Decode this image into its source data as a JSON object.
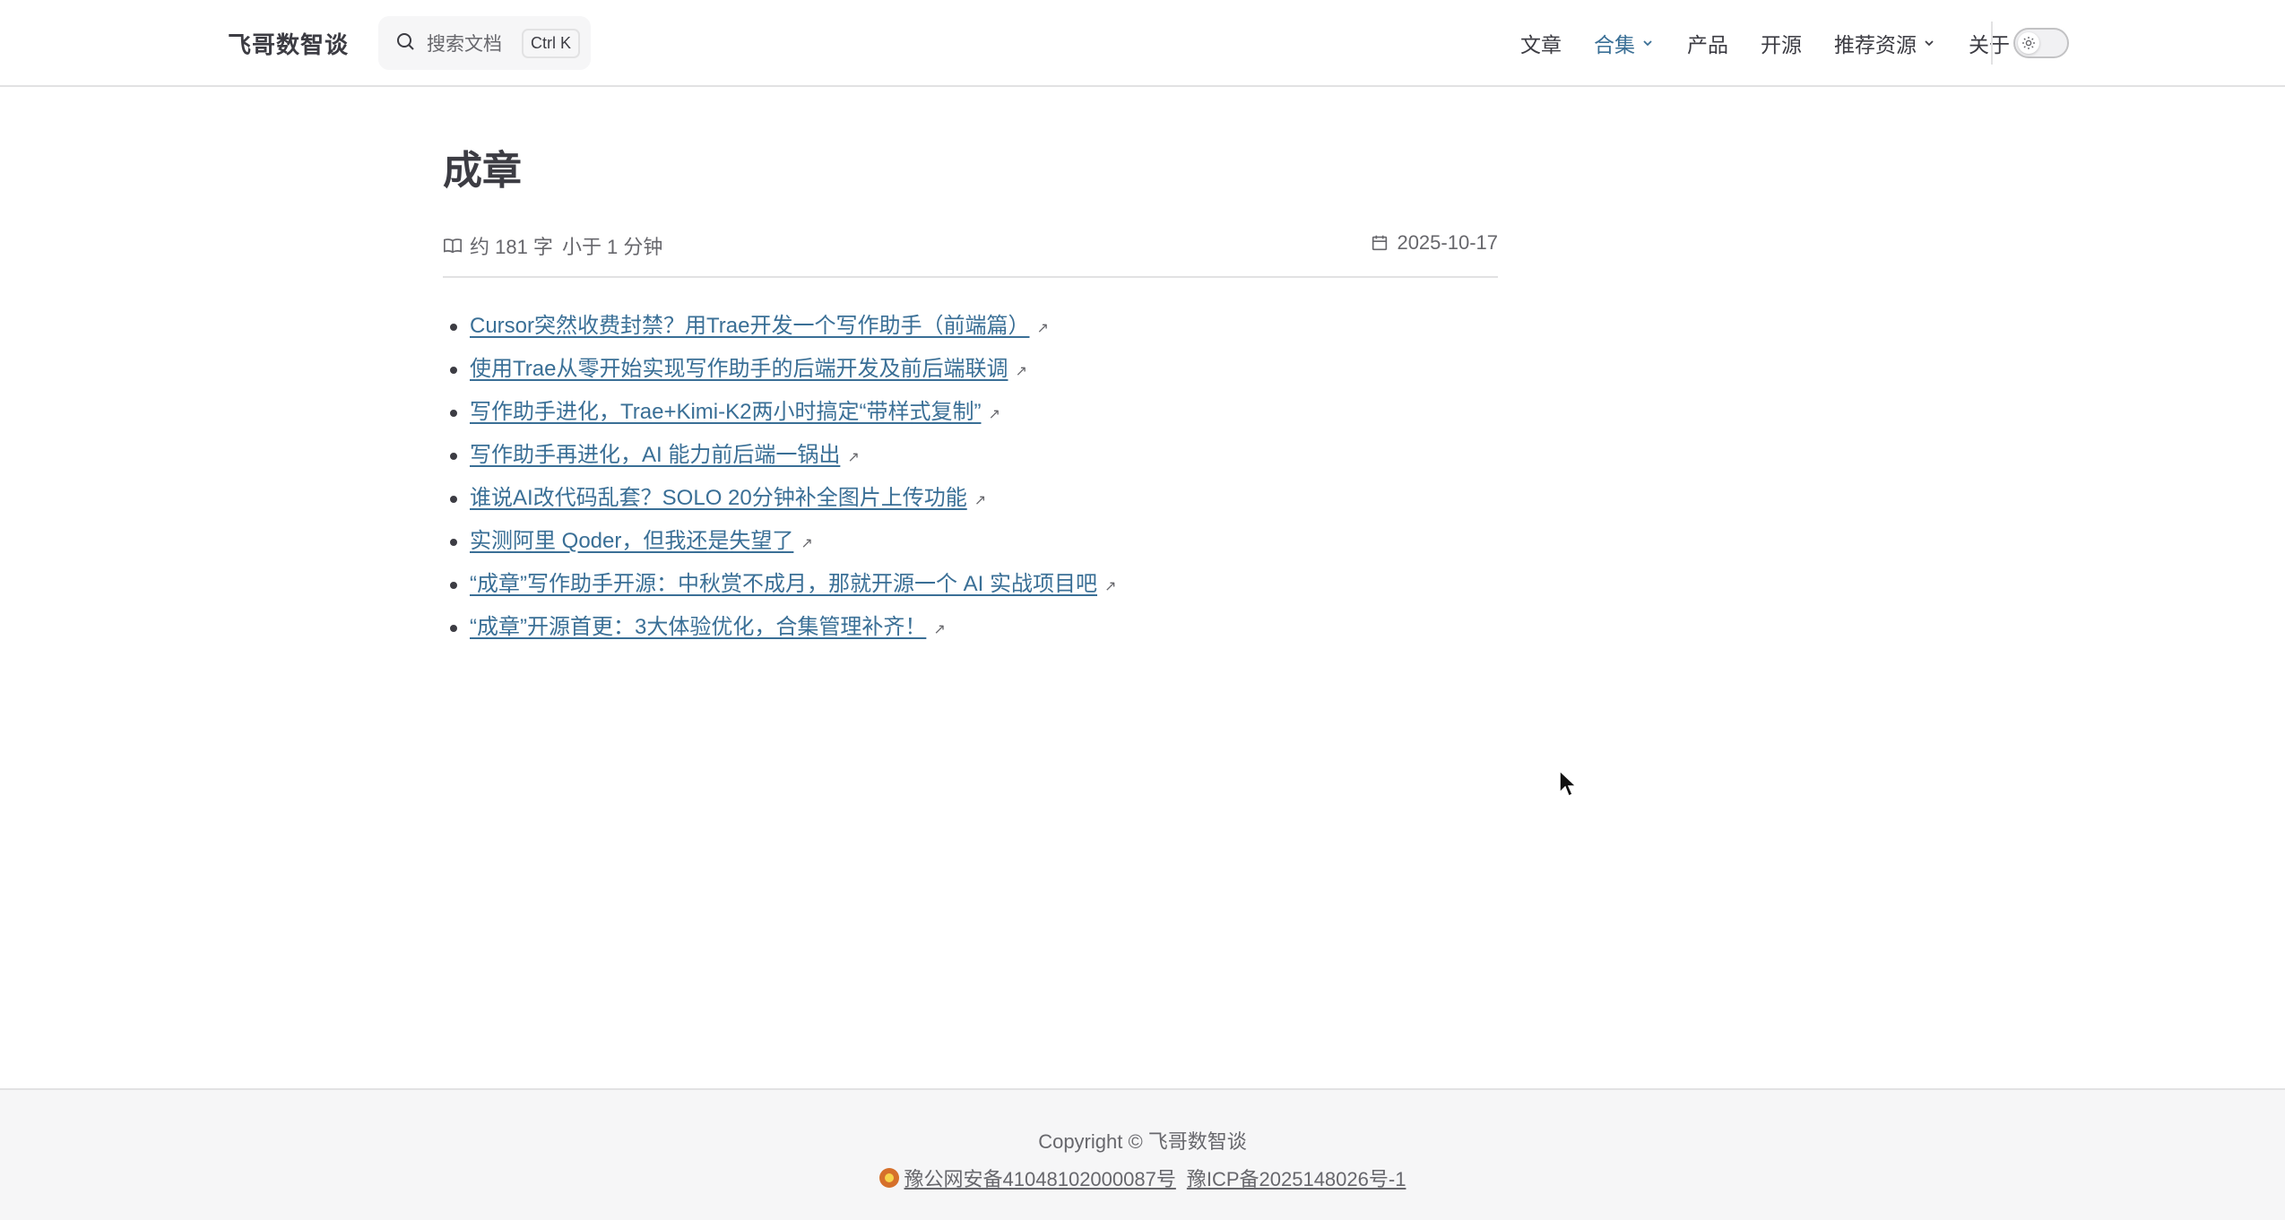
{
  "header": {
    "brand": "飞哥数智谈",
    "search": {
      "placeholder": "搜索文档",
      "shortcut": "Ctrl K"
    },
    "nav": [
      {
        "label": "文章",
        "active": false,
        "dropdown": false
      },
      {
        "label": "合集",
        "active": true,
        "dropdown": true
      },
      {
        "label": "产品",
        "active": false,
        "dropdown": false
      },
      {
        "label": "开源",
        "active": false,
        "dropdown": false
      },
      {
        "label": "推荐资源",
        "active": false,
        "dropdown": true
      },
      {
        "label": "关于",
        "active": false,
        "dropdown": false
      }
    ],
    "theme_toggle": {
      "icon": "sun-icon",
      "state": "light"
    }
  },
  "page": {
    "title": "成章",
    "meta": {
      "words": "约 181 字",
      "read_time": "小于 1 分钟",
      "date": "2025-10-17"
    },
    "links": [
      "Cursor突然收费封禁？用Trae开发一个写作助手（前端篇）",
      "使用Trae从零开始实现写作助手的后端开发及前后端联调",
      "写作助手进化，Trae+Kimi-K2两小时搞定“带样式复制”",
      "写作助手再进化，AI 能力前后端一锅出",
      "谁说AI改代码乱套？SOLO 20分钟补全图片上传功能",
      "实测阿里 Qoder，但我还是失望了",
      "“成章”写作助手开源：中秋赏不成月，那就开源一个 AI 实战项目吧",
      "“成章”开源首更：3大体验优化，合集管理补齐！"
    ],
    "external_mark": "↗"
  },
  "footer": {
    "copyright": "Copyright © 飞哥数智谈",
    "police_record": "豫公网安备41048102000087号",
    "icp_record": "豫ICP备2025148026号-1"
  },
  "colors": {
    "accent": "#3a6f96",
    "text": "#3c3c43",
    "muted": "#67676c",
    "border": "#e2e2e3"
  }
}
